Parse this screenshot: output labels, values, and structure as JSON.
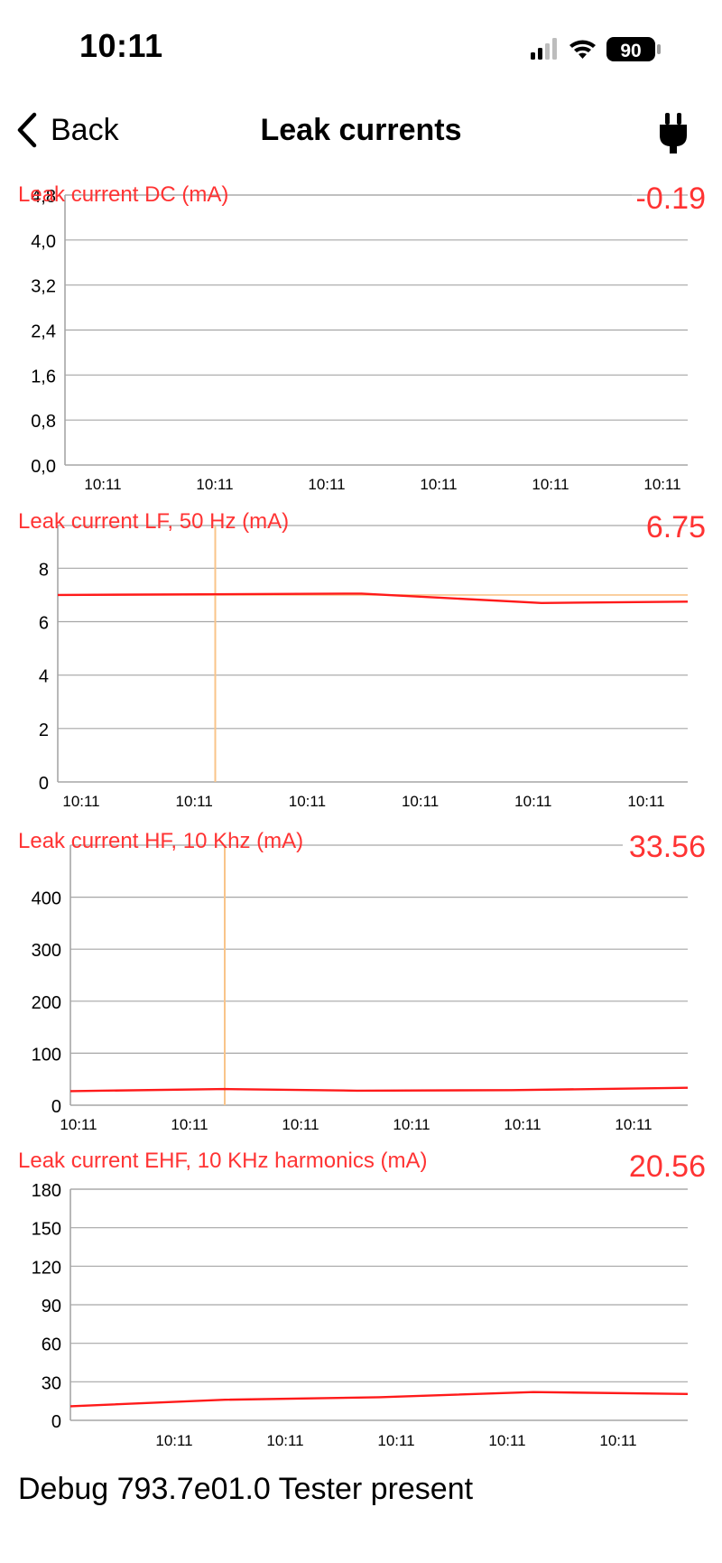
{
  "status_bar": {
    "time": "10:11",
    "battery": "90",
    "icons": [
      "signal-icon",
      "wifi-icon",
      "battery-icon"
    ]
  },
  "nav": {
    "back_label": "Back",
    "title": "Leak currents",
    "right_icon": "plug-icon"
  },
  "colors": {
    "series": "#ff1a1a",
    "title_text": "#ff3333",
    "cursor": "#f9c48a",
    "grid": "#a6a6a6"
  },
  "charts": [
    {
      "id": "dc",
      "title": "Leak current DC (mA)",
      "value": "-0.19",
      "y_tick_labels": [
        "0,0",
        "0,8",
        "1,6",
        "2,4",
        "3,2",
        "4,0",
        "4,8"
      ],
      "x_tick_labels": [
        "10:11",
        "10:11",
        "10:11",
        "10:11",
        "10:11",
        "10:11"
      ]
    },
    {
      "id": "lf",
      "title": "Leak current LF, 50 Hz (mA)",
      "value": "6.75",
      "y_tick_labels": [
        "0",
        "2",
        "4",
        "6",
        "8"
      ],
      "x_tick_labels": [
        "10:11",
        "10:11",
        "10:11",
        "10:11",
        "10:11",
        "10:11"
      ]
    },
    {
      "id": "hf",
      "title": "Leak current HF, 10 Khz (mA)",
      "value": "33.56",
      "y_tick_labels": [
        "0",
        "100",
        "200",
        "300",
        "400"
      ],
      "x_tick_labels": [
        "10:11",
        "10:11",
        "10:11",
        "10:11",
        "10:11",
        "10:11"
      ]
    },
    {
      "id": "ehf",
      "title": "Leak current EHF, 10 KHz harmonics (mA)",
      "value": "20.56",
      "y_tick_labels": [
        "0",
        "30",
        "60",
        "90",
        "120",
        "150",
        "180"
      ],
      "x_tick_labels": [
        "10:11",
        "10:11",
        "10:11",
        "10:11",
        "10:11"
      ]
    }
  ],
  "chart_data": [
    {
      "type": "line",
      "title": "Leak current DC (mA)",
      "ylim": [
        0,
        4.8
      ],
      "xlim": [
        0,
        5
      ],
      "grid": true,
      "series": [
        {
          "x": [],
          "y": []
        }
      ],
      "cursor_x": null
    },
    {
      "type": "line",
      "title": "Leak current LF, 50 Hz (mA)",
      "ylim": [
        0,
        9.6
      ],
      "xlim": [
        0,
        5.6
      ],
      "grid": true,
      "series": [
        {
          "x": [
            0,
            2.7,
            4.3,
            5.6
          ],
          "y": [
            7.0,
            7.05,
            6.7,
            6.75
          ]
        }
      ],
      "reference_y": 7.0,
      "cursor_x": 1.4
    },
    {
      "type": "line",
      "title": "Leak current HF, 10 Khz (mA)",
      "ylim": [
        0,
        500
      ],
      "xlim": [
        0,
        5.6
      ],
      "grid": true,
      "series": [
        {
          "x": [
            0,
            1.4,
            2.6,
            4.0,
            5.6
          ],
          "y": [
            27,
            31,
            28,
            29,
            33.56
          ]
        }
      ],
      "cursor_x": 1.4
    },
    {
      "type": "line",
      "title": "Leak current EHF, 10 KHz harmonics (mA)",
      "ylim": [
        0,
        180
      ],
      "xlim": [
        0,
        5.6
      ],
      "grid": true,
      "series": [
        {
          "x": [
            0,
            1.4,
            2.8,
            4.2,
            5.6
          ],
          "y": [
            11,
            16,
            18,
            22,
            20.56
          ]
        }
      ],
      "cursor_x": null
    }
  ],
  "debug": {
    "text": "Debug 793.7e01.0 Tester present"
  }
}
